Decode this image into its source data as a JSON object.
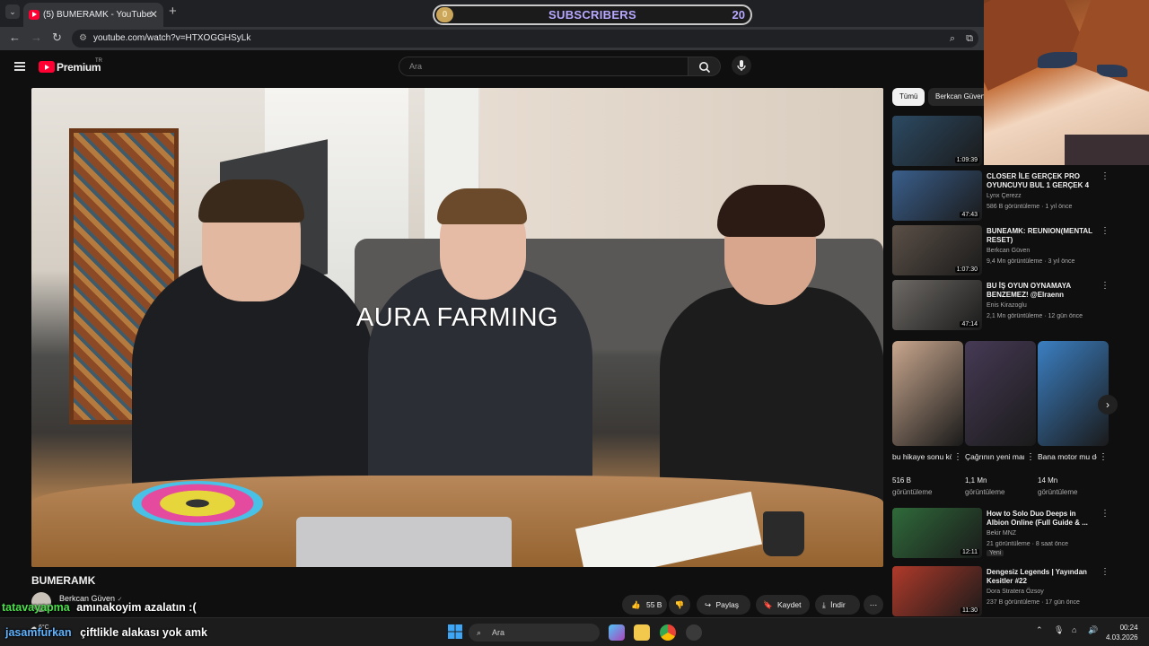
{
  "browser": {
    "tab_title": "(5) BUMERAMK - YouTube",
    "new_tab": "+",
    "url": "youtube.com/watch?v=HTXOGGHSyLk"
  },
  "sub_goal": {
    "coin": "0",
    "label": "SUBSCRIBERS",
    "count": "20"
  },
  "youtube": {
    "logo_text": "Premium",
    "region": "TR",
    "search_placeholder": "Ara"
  },
  "video": {
    "overlay_text": "AURA FARMING",
    "title": "BUMERAMK",
    "channel": "Berkcan Güven",
    "likes": "55 B",
    "share": "Paylaş",
    "save": "Kaydet",
    "download": "İndir"
  },
  "chips": [
    "Tümü",
    "Berkcan Güven"
  ],
  "recommended": [
    {
      "title": "",
      "channel": "",
      "meta": "",
      "duration": "1:09:39",
      "thumb": "#2c4a63"
    },
    {
      "title": "CLOSER İLE GERÇEK PRO OYUNCUYU BUL 1 GERÇEK 4 ...",
      "channel": "Lynx Çerezz",
      "meta": "586 B görüntüleme · 1 yıl önce",
      "duration": "47:43",
      "thumb": "#3a5f8c"
    },
    {
      "title": "BUNEAMK: REUNION(MENTAL RESET)",
      "channel": "Berkcan Güven",
      "meta": "9,4 Mn görüntüleme · 3 yıl önce",
      "duration": "1:07:30",
      "thumb": "#5b5047"
    },
    {
      "title": "BU İŞ OYUN OYNAMAYA BENZEMEZ! @Elraenn YEMEK...",
      "channel": "Enis Kirazoglu",
      "meta": "2,1 Mn görüntüleme · 12 gün önce",
      "duration": "47:14",
      "thumb": "#6e6a66"
    }
  ],
  "shorts": [
    {
      "title": "bu hikaye sonu kötü ...",
      "views": "516 B",
      "views_label": "görüntüleme",
      "thumb": "#c9a78e"
    },
    {
      "title": "Çağrının yeni manitası ...",
      "views": "1,1 Mn",
      "views_label": "görüntüleme",
      "thumb": "#463a55"
    },
    {
      "title": "Bana motor mu dedi? ...",
      "views": "14 Mn",
      "views_label": "görüntüleme",
      "thumb": "#3b7fc2"
    }
  ],
  "recommended2": [
    {
      "title": "How to Solo Duo Deeps in Albion Online (Full Guide & ...",
      "channel": "Bekir MNZ",
      "meta": "21 görüntüleme · 8 saat önce",
      "badge": "Yeni",
      "duration": "12:11",
      "thumb": "#2f6a3a"
    },
    {
      "title": "Dengesiz Legends | Yayından Kesitler #22",
      "channel": "Dora Stratera Özsoy",
      "meta": "237 B görüntüleme · 17 gün önce",
      "duration": "11:30",
      "thumb": "#b03a2a"
    }
  ],
  "chat": [
    {
      "user": "tatavayapma",
      "user_color": "#4be04b",
      "message": "amınakoyim azalatın :("
    },
    {
      "user": "jasamfurkan",
      "user_color": "#5fb3ff",
      "message": "çiftlikle alakası yok amk"
    }
  ],
  "taskbar": {
    "weather": "6°C",
    "search": "Ara",
    "time": "00:24",
    "date": "4.03.2026"
  }
}
